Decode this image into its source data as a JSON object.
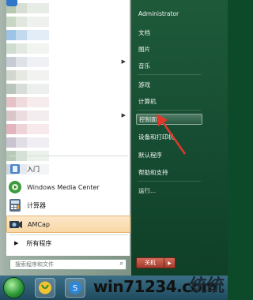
{
  "start_menu": {
    "blurred_program_rows": 13,
    "pinned": [
      {
        "label": "入门",
        "icon": "getting-started-icon"
      },
      {
        "label": "Windows Media Center",
        "icon": "media-center-icon"
      },
      {
        "label": "计算器",
        "icon": "calculator-icon"
      },
      {
        "label": "AMCap",
        "icon": "amcap-icon",
        "highlighted": true
      }
    ],
    "all_programs": "所有程序",
    "search_placeholder": "搜索程序和文件"
  },
  "right_pane": {
    "items": [
      {
        "label": "Administrator"
      },
      {
        "label": "文档"
      },
      {
        "label": "图片"
      },
      {
        "label": "音乐"
      },
      {
        "label": "游戏"
      },
      {
        "label": "计算机"
      },
      {
        "label": "控制面板",
        "active": true
      },
      {
        "label": "设备和打印机"
      },
      {
        "label": "默认程序"
      },
      {
        "label": "帮助和支持"
      },
      {
        "label": "运行..."
      }
    ],
    "shutdown_label": "关机"
  },
  "taskbar": {
    "watermark": "win71234.com",
    "watermark_extra": "统统"
  },
  "colors": {
    "right_pane": "#1a5236",
    "highlight": "#f8d7a4",
    "annotation_arrow": "#e0392b"
  }
}
